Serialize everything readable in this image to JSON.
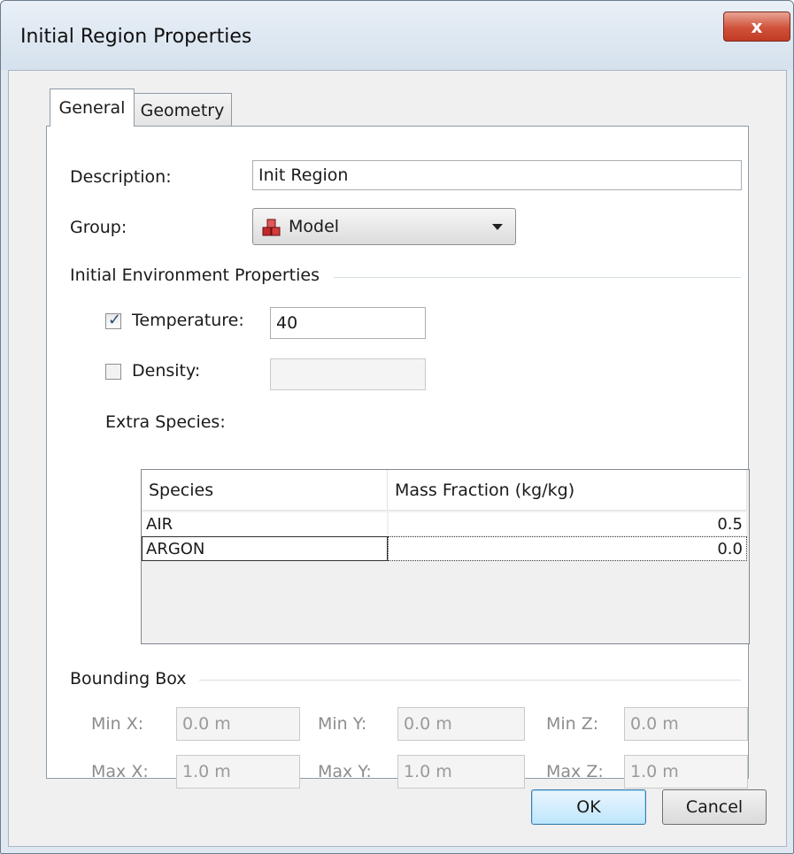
{
  "window": {
    "title": "Initial Region Properties",
    "close_glyph": "x"
  },
  "tabs": [
    {
      "label": "General",
      "active": true
    },
    {
      "label": "Geometry",
      "active": false
    }
  ],
  "general": {
    "description_label": "Description:",
    "description_value": "Init Region",
    "group_label": "Group:",
    "group_value": "Model",
    "group_icon": "model-blocks-icon"
  },
  "initial_env": {
    "section_label": "Initial Environment Properties",
    "temperature": {
      "label": "Temperature:",
      "checked": true,
      "value": "40"
    },
    "density": {
      "label": "Density:",
      "checked": false,
      "value": ""
    },
    "extra_species_label": "Extra Species:"
  },
  "species_table": {
    "columns": [
      "Species",
      "Mass Fraction (kg/kg)"
    ],
    "rows": [
      {
        "species": "AIR",
        "mass_fraction": "0.5"
      },
      {
        "species": "ARGON",
        "mass_fraction": "0.0"
      }
    ]
  },
  "bounding_box": {
    "section_label": "Bounding Box",
    "min_x_label": "Min X:",
    "min_x": "0.0 m",
    "min_y_label": "Min Y:",
    "min_y": "0.0 m",
    "min_z_label": "Min Z:",
    "min_z": "0.0 m",
    "max_x_label": "Max X:",
    "max_x": "1.0 m",
    "max_y_label": "Max Y:",
    "max_y": "1.0 m",
    "max_z_label": "Max Z:",
    "max_z": "1.0 m"
  },
  "buttons": {
    "ok": "OK",
    "cancel": "Cancel"
  },
  "colors": {
    "close_button": "#c94a33",
    "ok_button": "#bee6fd",
    "group_icon": "#c0282a"
  }
}
